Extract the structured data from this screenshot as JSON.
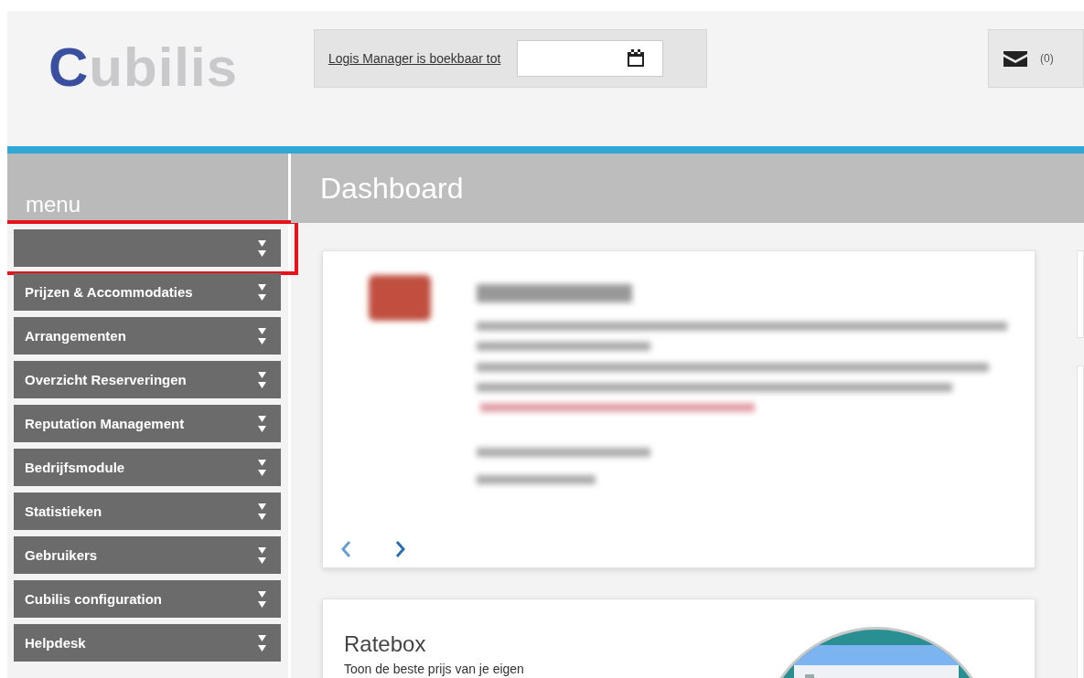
{
  "logo": {
    "first_letter": "C",
    "rest": "ubilis"
  },
  "booking_bar": {
    "link": "Logis Manager is boekbaar tot"
  },
  "messages": {
    "count": "(0)"
  },
  "sidebar": {
    "title": "menu",
    "items": [
      {
        "highlighted": true
      },
      {
        "label": "Prijzen & Accommodaties",
        "highlighted": false
      },
      {
        "label": "Arrangementen",
        "highlighted": false
      },
      {
        "label": "Overzicht Reserveringen",
        "highlighted": false
      },
      {
        "label": "Reputation Management",
        "highlighted": false
      },
      {
        "label": "Bedrijfsmodule",
        "highlighted": false
      },
      {
        "label": "Statistieken",
        "highlighted": false
      },
      {
        "label": "Gebruikers",
        "highlighted": false
      },
      {
        "label": "Cubilis configuration",
        "highlighted": false
      },
      {
        "label": "Helpdesk",
        "highlighted": false
      }
    ]
  },
  "page": {
    "title": "Dashboard"
  },
  "ratebox": {
    "title": "Ratebox",
    "text": "Toon de beste prijs van je eigen"
  }
}
